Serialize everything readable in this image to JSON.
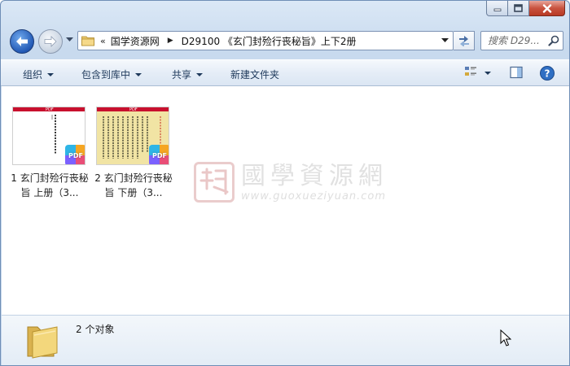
{
  "address": {
    "overflow": "«",
    "crumbs": [
      "国学资源网",
      "D29100 《玄门封殓行丧秘旨》上下2册"
    ]
  },
  "search": {
    "placeholder": "搜索 D29..."
  },
  "toolbar": {
    "organize": "组织",
    "include_library": "包含到库中",
    "share": "共享",
    "new_folder": "新建文件夹"
  },
  "files": [
    {
      "name": "1 玄门封殓行丧秘旨 上册（3...",
      "badge": "PDF"
    },
    {
      "name": "2 玄门封殓行丧秘旨 下册（3...",
      "badge": "PDF"
    }
  ],
  "watermark": {
    "cn": "國學資源網",
    "url": "www.guoxueziyuan.com"
  },
  "status": {
    "count": "2 个对象"
  },
  "thumb_label": "PDF",
  "colors": {
    "pdf_red": "#c8102e",
    "accent": "#2259b5"
  }
}
